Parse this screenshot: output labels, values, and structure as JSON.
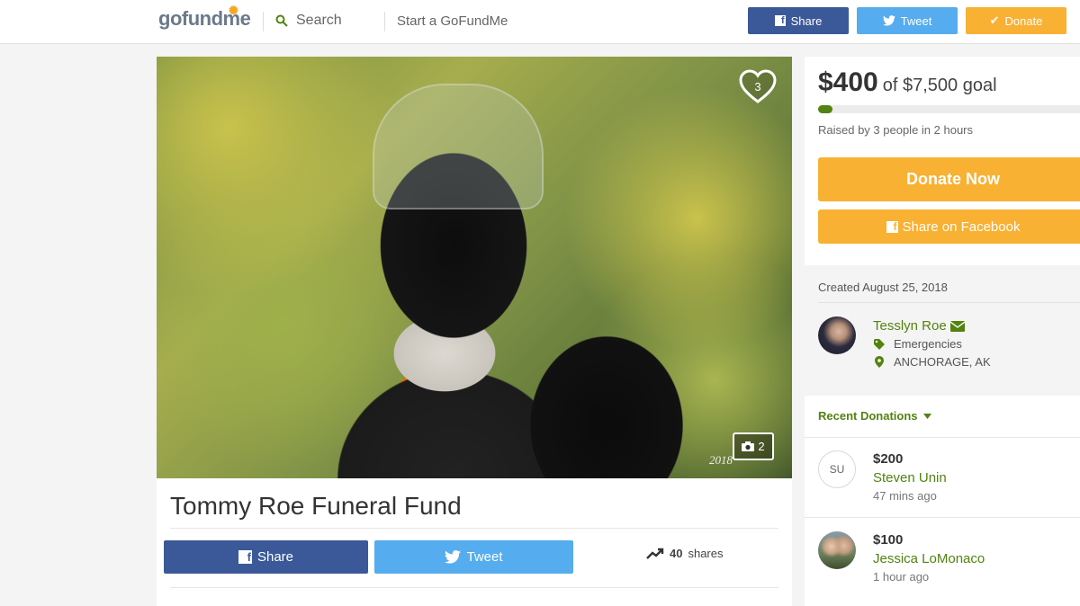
{
  "header": {
    "logo_text": "gofundme",
    "search_label": "Search",
    "start_label": "Start a GoFundMe",
    "share_label": "Share",
    "tweet_label": "Tweet",
    "donate_label": "Donate"
  },
  "campaign": {
    "title": "Tommy Roe Funeral Fund",
    "heart_count": "3",
    "photo_count": "2",
    "photo_year": "2018",
    "share_label": "Share",
    "tweet_label": "Tweet",
    "shares_count": "40",
    "shares_label": "shares"
  },
  "sidebar": {
    "raised": "$400",
    "goal_text": "of $7,500 goal",
    "progress_fraction": 0.0533,
    "raised_by": "Raised by 3 people in 2 hours",
    "donate_now_label": "Donate Now",
    "share_facebook_label": "Share on Facebook",
    "created": "Created August 25, 2018",
    "organizer": {
      "name": "Tesslyn Roe",
      "category": "Emergencies",
      "location": "ANCHORAGE, AK"
    },
    "recent_heading": "Recent Donations",
    "donations": [
      {
        "initials": "SU",
        "amount": "$200",
        "name": "Steven Unin",
        "time": "47 mins ago"
      },
      {
        "initials": "",
        "amount": "$100",
        "name": "Jessica LoMonaco",
        "time": "1 hour ago"
      }
    ]
  },
  "colors": {
    "facebook": "#3b5998",
    "twitter": "#55acee",
    "donate": "#f8b133",
    "brand_green": "#52830f"
  },
  "icons": [
    "search-icon",
    "facebook-icon",
    "twitter-icon",
    "check-icon",
    "heart-icon",
    "camera-icon",
    "trending-icon",
    "envelope-icon",
    "tag-icon",
    "map-pin-icon",
    "caret-down-icon"
  ]
}
